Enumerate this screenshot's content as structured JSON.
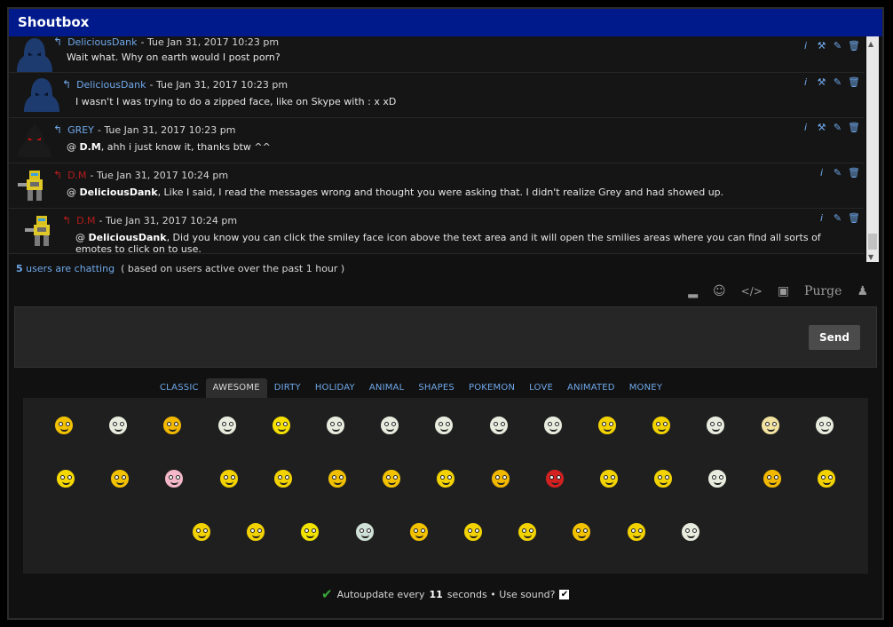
{
  "header": {
    "title": "Shoutbox"
  },
  "messages": [
    {
      "name": "DeliciousDank",
      "date": "Tue Jan 31, 2017 10:23 pm",
      "text": "Wait what. Why on earth would I post porn?",
      "name_color": "#6fa8ea",
      "avatar": "blue-hooded-avatar",
      "reply_color": "#6fa8ea",
      "actions": [
        "info-icon",
        "tools-icon",
        "edit-icon",
        "delete-icon"
      ]
    },
    {
      "name": "DeliciousDank",
      "date": "Tue Jan 31, 2017 10:23 pm",
      "text": "I wasn't I was trying to do a zipped face, like on Skype with : x xD",
      "name_color": "#6fa8ea",
      "avatar": "blue-hooded-avatar",
      "reply_color": "#6fa8ea",
      "actions": [
        "info-icon",
        "tools-icon",
        "edit-icon",
        "delete-icon"
      ]
    },
    {
      "name": "GREY",
      "date": "Tue Jan 31, 2017 10:23 pm",
      "mention": "D.M",
      "text": ", ahh i just know it, thanks btw ^^",
      "name_color": "#6fa8ea",
      "avatar": "red-eyed-shadow-avatar",
      "reply_color": "#6fa8ea",
      "actions": [
        "info-icon",
        "tools-icon",
        "edit-icon",
        "delete-icon"
      ]
    },
    {
      "name": "D.M",
      "date": "Tue Jan 31, 2017 10:24 pm",
      "mention": "DeliciousDank",
      "text": ", Like I said, I read the messages wrong and thought you were asking that. I didn't realize Grey and had showed up.",
      "name_color": "#b41c1c",
      "avatar": "robot-avatar",
      "reply_color": "#b41c1c",
      "actions": [
        "info-icon",
        "edit-icon",
        "delete-icon"
      ]
    },
    {
      "name": "D.M",
      "date": "Tue Jan 31, 2017 10:24 pm",
      "mention": "DeliciousDank",
      "text": ", Did you know you can click the smiley face icon above the text area and it will open the smilies areas where you can find all sorts of emotes to click on to use.",
      "name_color": "#b41c1c",
      "avatar": "robot-avatar",
      "reply_color": "#b41c1c",
      "actions": [
        "info-icon",
        "edit-icon",
        "delete-icon"
      ]
    }
  ],
  "chatting": {
    "count": "5",
    "link_text": "users are chatting",
    "note": "( based on users active over the past 1 hour )"
  },
  "toolbar": {
    "icons": [
      "eraser-icon",
      "smiley-icon",
      "code-icon",
      "archive-icon"
    ],
    "purge_label": "Purge",
    "last_icon": "user-icon"
  },
  "input": {
    "send_label": "Send"
  },
  "tabs": [
    "CLASSIC",
    "AWESOME",
    "DIRTY",
    "HOLIDAY",
    "ANIMAL",
    "SHAPES",
    "POKEMON",
    "LOVE",
    "ANIMATED",
    "MONEY"
  ],
  "active_tab": "AWESOME",
  "smilies": [
    [
      "#f2c200",
      "#e8ecde",
      "#f2b800",
      "#e8ecde",
      "#f5e000",
      "#e8ecde",
      "#e8ecde",
      "#e8ecde",
      "#e8ecde",
      "#e8ecde",
      "#f2d200",
      "#f2d200",
      "#e8ecde",
      "#f2e2a0",
      "#e8ecde"
    ],
    [
      "#f5d800",
      "#f2c200",
      "#f4b8c8",
      "#f2d200",
      "#f2d200",
      "#f0c000",
      "#f2c200",
      "#f2d200",
      "#f2b800",
      "#d42020",
      "#f2d200",
      "#f2d200",
      "#e8ecde",
      "#f2b800",
      "#f2d200"
    ],
    [
      "#f2d200",
      "#f2d200",
      "#f2e200",
      "#cfe0d6",
      "#f2c200",
      "#f2d200",
      "#f2d200",
      "#f2c200",
      "#f2d200",
      "#e8ecde"
    ]
  ],
  "footer": {
    "prefix": "Autoupdate every",
    "seconds": "11",
    "suffix": "seconds • Use sound?"
  }
}
